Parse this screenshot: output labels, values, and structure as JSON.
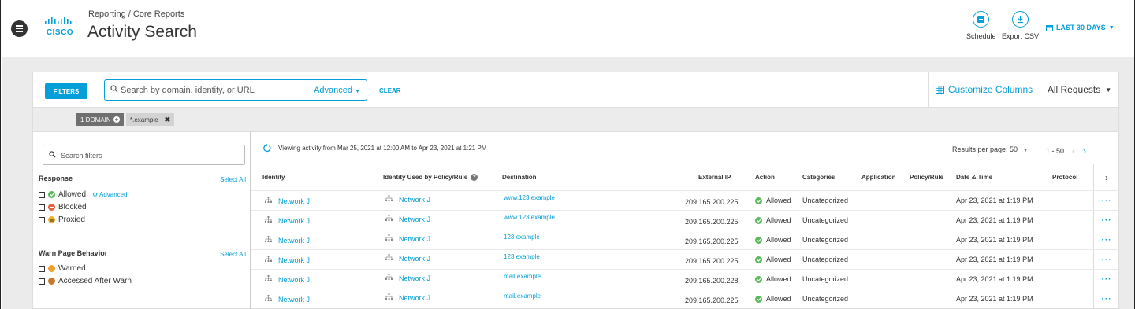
{
  "header": {
    "breadcrumb": "Reporting / Core Reports",
    "title": "Activity Search",
    "logo_text": "CISCO",
    "schedule_label": "Schedule",
    "export_label": "Export CSV",
    "date_range": "LAST 30 DAYS"
  },
  "filter_bar": {
    "filters_label": "FILTERS",
    "search_placeholder": "Search by domain, identity, or URL",
    "advanced_label": "Advanced",
    "clear_label": "CLEAR",
    "customize_label": "Customize Columns",
    "requests_label": "All Requests"
  },
  "chips": {
    "domain_label": "1 DOMAIN",
    "domain_value": "*.example"
  },
  "sidebar": {
    "search_placeholder": "Search filters",
    "response_title": "Response",
    "select_all": "Select All",
    "response_options": [
      "Allowed",
      "Blocked",
      "Proxied"
    ],
    "advanced_label": "Advanced",
    "warn_title": "Warn Page Behavior",
    "warn_options": [
      "Warned",
      "Accessed After Warn"
    ]
  },
  "main": {
    "viewing_text": "Viewing activity from Mar 25, 2021 at 12:00 AM to Apr 23, 2021 at 1:21 PM",
    "results_per_page": "Results per page:  50",
    "page_range": "1 - 50",
    "columns": [
      "Identity",
      "Identity Used by Policy/Rule",
      "Destination",
      "External IP",
      "Action",
      "Categories",
      "Application",
      "Policy/Rule",
      "Date & Time",
      "Protocol"
    ],
    "rows": [
      {
        "identity": "Network J",
        "policy_identity": "Network J",
        "destination": "www.123.example",
        "ip": "209.165.200.225",
        "action": "Allowed",
        "category": "Uncategorized",
        "datetime": "Apr 23, 2021 at 1:19 PM"
      },
      {
        "identity": "Network J",
        "policy_identity": "Network J",
        "destination": "www.123.example",
        "ip": "209.165.200.225",
        "action": "Allowed",
        "category": "Uncategorized",
        "datetime": "Apr 23, 2021 at 1:19 PM"
      },
      {
        "identity": "Network J",
        "policy_identity": "Network J",
        "destination": "123.example",
        "ip": "209.165.200.225",
        "action": "Allowed",
        "category": "Uncategorized",
        "datetime": "Apr 23, 2021 at 1:19 PM"
      },
      {
        "identity": "Network J",
        "policy_identity": "Network J",
        "destination": "123.example",
        "ip": "209.165.200.225",
        "action": "Allowed",
        "category": "Uncategorized",
        "datetime": "Apr 23, 2021 at 1:19 PM"
      },
      {
        "identity": "Network J",
        "policy_identity": "Network J",
        "destination": "mail.example",
        "ip": "209.165.200.228",
        "action": "Allowed",
        "category": "Uncategorized",
        "datetime": "Apr 23, 2021 at 1:19 PM"
      },
      {
        "identity": "Network J",
        "policy_identity": "Network J",
        "destination": "mail.example",
        "ip": "209.165.200.225",
        "action": "Allowed",
        "category": "Uncategorized",
        "datetime": "Apr 23, 2021 at 1:19 PM"
      }
    ],
    "row_menu": "···"
  },
  "colors": {
    "accent": "#049fd9",
    "allowed": "#5cb85c",
    "blocked": "#e8603c",
    "proxied": "#f0b323",
    "warned": "#f0a030",
    "accessed": "#c8782a"
  }
}
